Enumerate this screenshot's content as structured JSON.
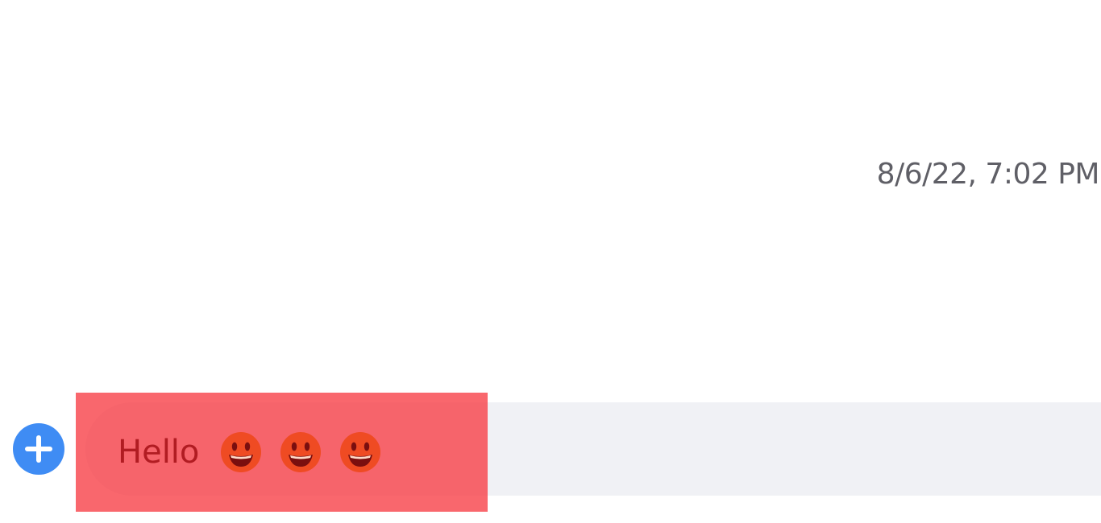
{
  "conversation": {
    "timestamp": "8/6/22, 7:02 PM"
  },
  "composer": {
    "add_button_icon": "plus-circle-icon",
    "message_text": "Hello",
    "emojis": [
      "smiling-face-icon",
      "smiling-face-icon",
      "smiling-face-icon"
    ],
    "highlight_color": "#f73c44"
  },
  "colors": {
    "accent": "#3f8cf4",
    "input_background": "#f0f1f5",
    "timestamp_text": "#5f5f66"
  }
}
